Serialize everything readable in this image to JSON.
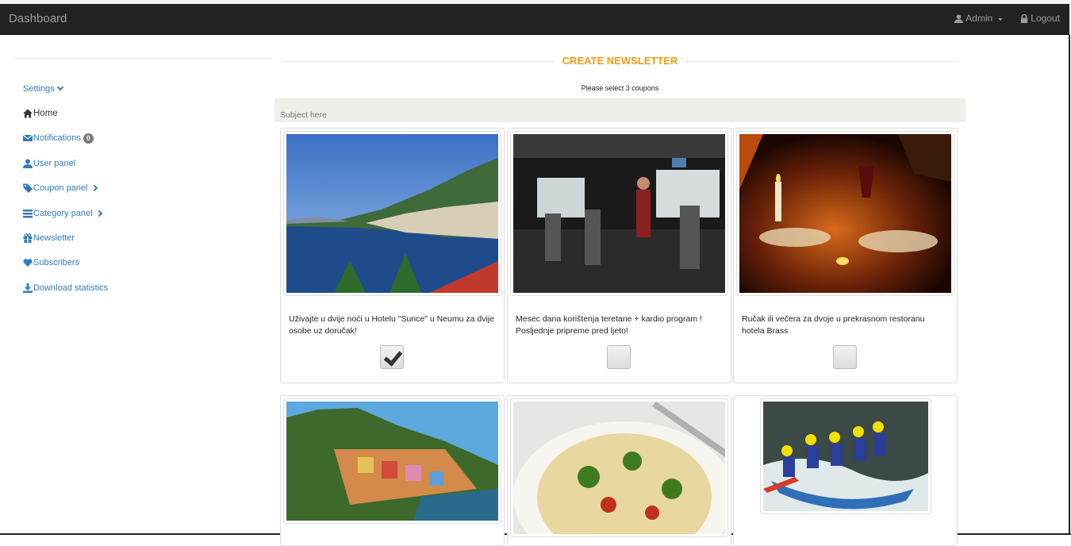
{
  "navbar": {
    "brand": "Dashboard",
    "user_label": "Admin",
    "logout_label": "Logout"
  },
  "sidebar": {
    "items": [
      {
        "label": "Settings",
        "icon": "chevron-down-icon"
      },
      {
        "label": "Home",
        "icon": "home-icon"
      },
      {
        "label": "Notifications",
        "icon": "envelope-icon",
        "badge": "0"
      },
      {
        "label": "User panel",
        "icon": "user-icon"
      },
      {
        "label": "Coupon panel",
        "icon": "tag-icon"
      },
      {
        "label": "Category panel",
        "icon": "list-icon"
      },
      {
        "label": "Newsletter",
        "icon": "gift-icon"
      },
      {
        "label": "Subscribers",
        "icon": "heart-icon"
      },
      {
        "label": "Download statistics",
        "icon": "download-icon"
      }
    ]
  },
  "main": {
    "title": "CREATE NEWSLETTER",
    "instruction": "Please select 3 coupons",
    "subject_placeholder": "Subject here"
  },
  "coupons": [
    {
      "description": "Uživajte u dvije noći u Hotelu \"Sunce\" u Neumu za dvije osobe uz doručak!",
      "checked": true
    },
    {
      "description": "Mesec dana korištenja teretane + kardio program ! Posljednje pripreme pred ljeto!",
      "checked": false
    },
    {
      "description": "Ručak ili večera za dvoje u prekrasnom restoranu hotela Brass",
      "checked": false
    },
    {
      "description": "",
      "checked": false
    },
    {
      "description": "",
      "checked": false
    },
    {
      "description": "",
      "checked": false
    }
  ],
  "colors": {
    "navbar": "#222222",
    "accent": "#f39c12",
    "link": "#337ab7",
    "subject_bg": "#efefea"
  }
}
